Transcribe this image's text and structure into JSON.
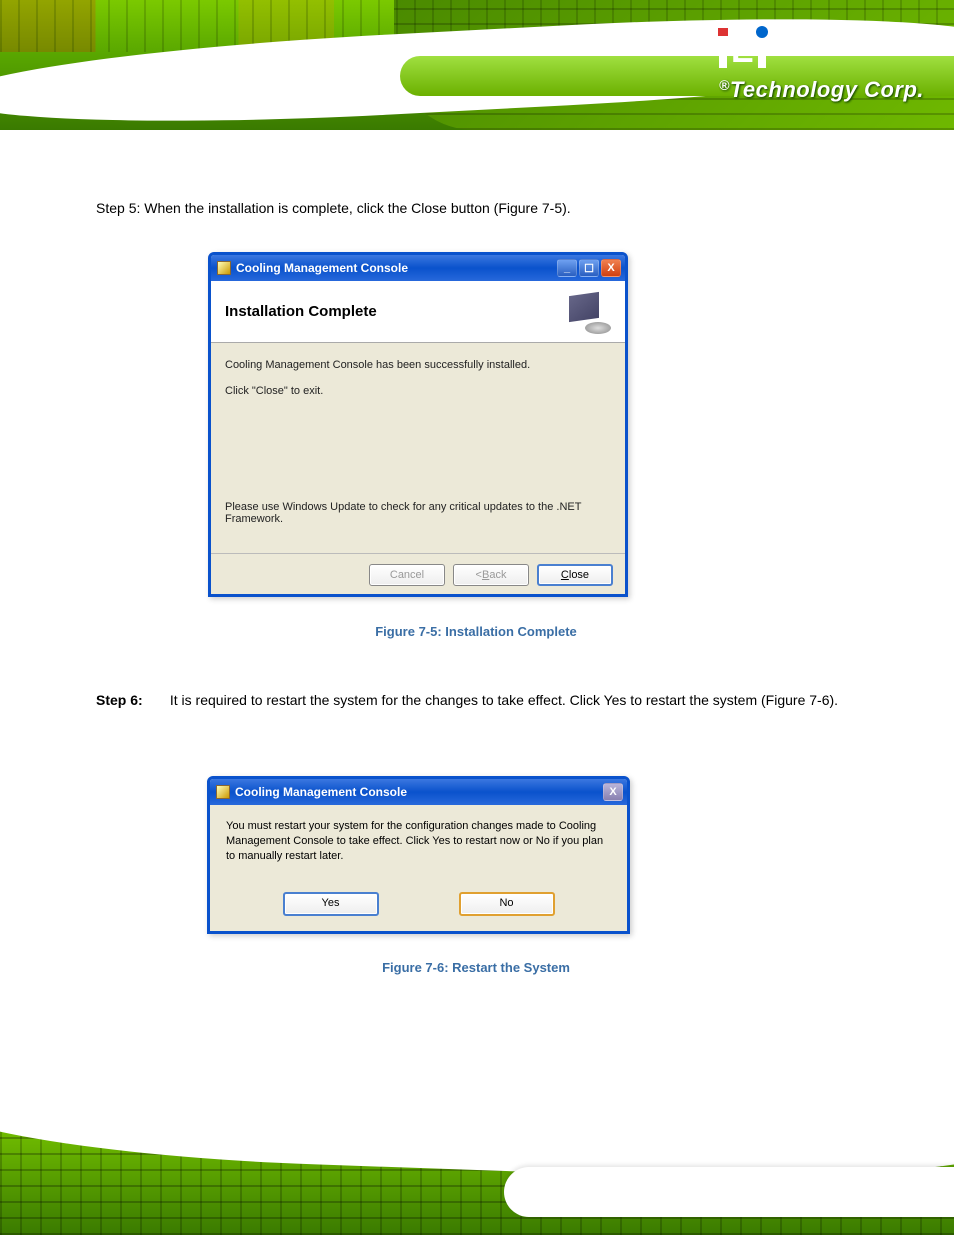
{
  "header": {
    "logo_text": "Technology Corp."
  },
  "dialog1": {
    "title": "Cooling Management Console",
    "heading": "Installation Complete",
    "body_line1": "Cooling Management Console has been successfully installed.",
    "body_line2": "Click \"Close\" to exit.",
    "net_note": "Please use Windows Update to check for any critical updates to the .NET Framework.",
    "buttons": {
      "cancel": "Cancel",
      "back": "< Back",
      "close": "Close"
    },
    "win_min": "_",
    "win_max": "☐",
    "win_close": "X"
  },
  "dialog2": {
    "title": "Cooling Management Console",
    "message": "You must restart your system for the configuration changes made to Cooling Management Console to take effect. Click Yes to restart now or No if you plan to manually restart later.",
    "yes": "Yes",
    "no": "No",
    "win_close": "X"
  },
  "steps": {
    "step5": "Step 5:  When the installation is complete, click the Close button (Figure 7-5).",
    "fig5": "Figure 7-5: Installation Complete",
    "step6_label": "Step 6:",
    "step6_text": "It is required to restart the system for the changes to take effect. Click Yes to restart the system (Figure 7-6).",
    "fig6": "Figure 7-6: Restart the System"
  }
}
